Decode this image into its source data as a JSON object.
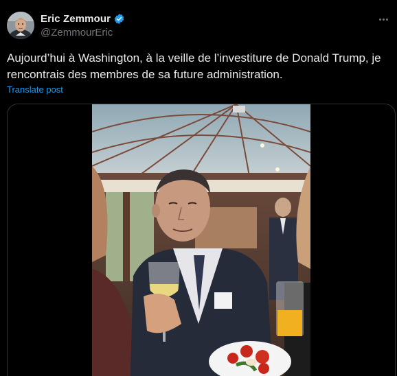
{
  "author": {
    "display_name": "Eric Zemmour",
    "handle": "@ZemmourEric",
    "verified": true,
    "avatar_icon": "profile-photo"
  },
  "post": {
    "text": "Aujourd’hui à Washington, à la veille de l’investiture de Donald Trump, je rencontrais des membres de sa future administration.",
    "translate_label": "Translate post"
  },
  "media": {
    "type": "video",
    "description_icon": "video-frame"
  },
  "colors": {
    "background": "#000000",
    "text_primary": "#e7e9ea",
    "text_secondary": "#71767b",
    "link": "#1d9bf0",
    "verified_badge": "#1d9bf0",
    "border": "#2f3336"
  },
  "icons": {
    "more": "more-horizontal-icon",
    "verified": "verified-badge-icon"
  }
}
